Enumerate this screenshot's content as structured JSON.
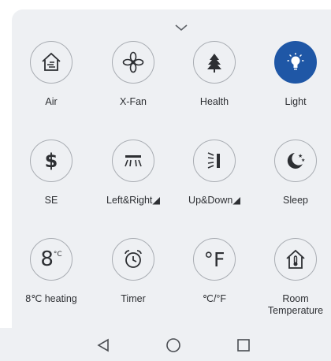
{
  "controls": [
    {
      "label": "Air",
      "icon": "air-icon",
      "active": false
    },
    {
      "label": "X-Fan",
      "icon": "fan-icon",
      "active": false
    },
    {
      "label": "Health",
      "icon": "tree-icon",
      "active": false
    },
    {
      "label": "Light",
      "icon": "light-bulb-icon",
      "active": true
    },
    {
      "label": "SE",
      "icon": "dollar-icon",
      "active": false
    },
    {
      "label": "Left&Right◢",
      "icon": "left-right-swing-icon",
      "active": false
    },
    {
      "label": "Up&Down◢",
      "icon": "up-down-swing-icon",
      "active": false
    },
    {
      "label": "Sleep",
      "icon": "moon-stars-icon",
      "active": false
    },
    {
      "label": "8℃ heating",
      "icon": "8c-heating-icon",
      "active": false,
      "glyph_text": "8",
      "glyph_sup": "°C"
    },
    {
      "label": "Timer",
      "icon": "alarm-clock-icon",
      "active": false
    },
    {
      "label": "℃/°F",
      "icon": "fahrenheit-icon",
      "active": false,
      "glyph_text": "°F"
    },
    {
      "label": "Room\nTemperature",
      "icon": "home-thermometer-icon",
      "active": false
    }
  ],
  "colors": {
    "accent": "#1f57a6",
    "panel": "#eef0f3",
    "text": "#2d2f33",
    "ring": "#a9adb3"
  },
  "navbar": {
    "back": "back-triangle-icon",
    "home": "home-circle-icon",
    "recents": "recents-square-icon"
  }
}
